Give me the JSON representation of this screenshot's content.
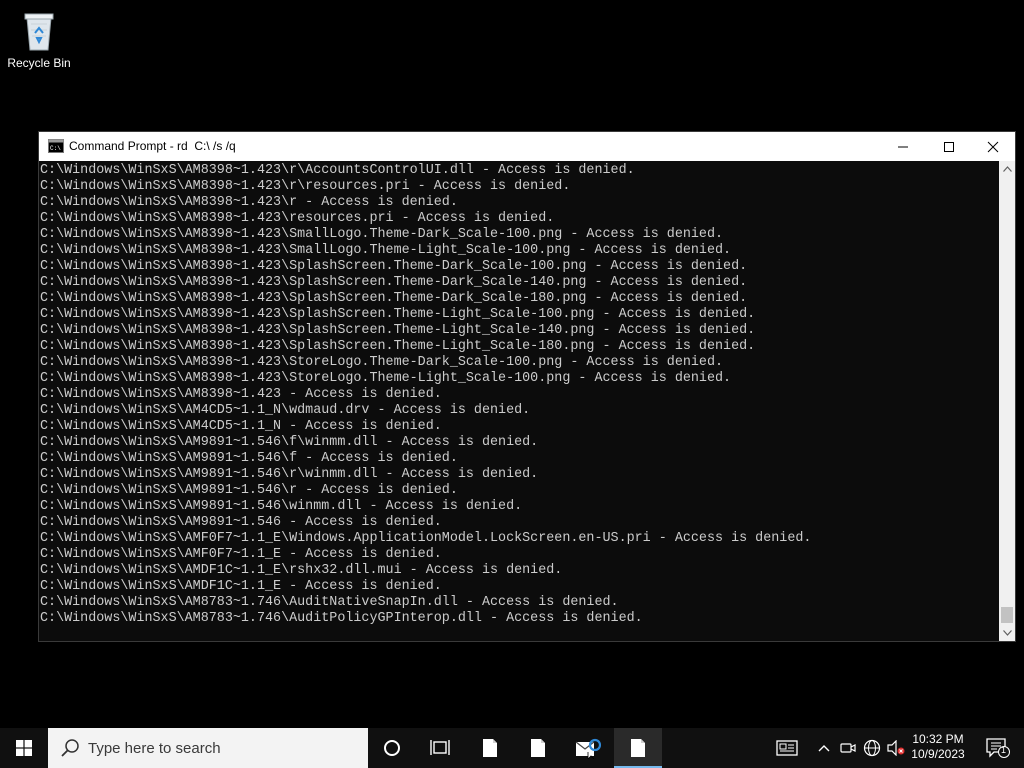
{
  "desktop": {
    "icons": [
      {
        "label": "Recycle Bin",
        "icon": "recycle-bin-icon"
      }
    ]
  },
  "window": {
    "title": "Command Prompt - rd  C:\\ /s /q",
    "icon": "cmd-icon",
    "controls": {
      "minimize": "minimize-icon",
      "maximize": "maximize-icon",
      "close": "close-icon"
    },
    "colors": {
      "console_bg": "#0c0c0c",
      "console_text": "#cccccc",
      "titlebar_bg": "#ffffff"
    },
    "console_lines": [
      "C:\\Windows\\WinSxS\\AM8398~1.423\\r\\AccountsControlUI.dll - Access is denied.",
      "C:\\Windows\\WinSxS\\AM8398~1.423\\r\\resources.pri - Access is denied.",
      "C:\\Windows\\WinSxS\\AM8398~1.423\\r - Access is denied.",
      "C:\\Windows\\WinSxS\\AM8398~1.423\\resources.pri - Access is denied.",
      "C:\\Windows\\WinSxS\\AM8398~1.423\\SmallLogo.Theme-Dark_Scale-100.png - Access is denied.",
      "C:\\Windows\\WinSxS\\AM8398~1.423\\SmallLogo.Theme-Light_Scale-100.png - Access is denied.",
      "C:\\Windows\\WinSxS\\AM8398~1.423\\SplashScreen.Theme-Dark_Scale-100.png - Access is denied.",
      "C:\\Windows\\WinSxS\\AM8398~1.423\\SplashScreen.Theme-Dark_Scale-140.png - Access is denied.",
      "C:\\Windows\\WinSxS\\AM8398~1.423\\SplashScreen.Theme-Dark_Scale-180.png - Access is denied.",
      "C:\\Windows\\WinSxS\\AM8398~1.423\\SplashScreen.Theme-Light_Scale-100.png - Access is denied.",
      "C:\\Windows\\WinSxS\\AM8398~1.423\\SplashScreen.Theme-Light_Scale-140.png - Access is denied.",
      "C:\\Windows\\WinSxS\\AM8398~1.423\\SplashScreen.Theme-Light_Scale-180.png - Access is denied.",
      "C:\\Windows\\WinSxS\\AM8398~1.423\\StoreLogo.Theme-Dark_Scale-100.png - Access is denied.",
      "C:\\Windows\\WinSxS\\AM8398~1.423\\StoreLogo.Theme-Light_Scale-100.png - Access is denied.",
      "C:\\Windows\\WinSxS\\AM8398~1.423 - Access is denied.",
      "C:\\Windows\\WinSxS\\AM4CD5~1.1_N\\wdmaud.drv - Access is denied.",
      "C:\\Windows\\WinSxS\\AM4CD5~1.1_N - Access is denied.",
      "C:\\Windows\\WinSxS\\AM9891~1.546\\f\\winmm.dll - Access is denied.",
      "C:\\Windows\\WinSxS\\AM9891~1.546\\f - Access is denied.",
      "C:\\Windows\\WinSxS\\AM9891~1.546\\r\\winmm.dll - Access is denied.",
      "C:\\Windows\\WinSxS\\AM9891~1.546\\r - Access is denied.",
      "C:\\Windows\\WinSxS\\AM9891~1.546\\winmm.dll - Access is denied.",
      "C:\\Windows\\WinSxS\\AM9891~1.546 - Access is denied.",
      "C:\\Windows\\WinSxS\\AMF0F7~1.1_E\\Windows.ApplicationModel.LockScreen.en-US.pri - Access is denied.",
      "C:\\Windows\\WinSxS\\AMF0F7~1.1_E - Access is denied.",
      "C:\\Windows\\WinSxS\\AMDF1C~1.1_E\\rshx32.dll.mui - Access is denied.",
      "C:\\Windows\\WinSxS\\AMDF1C~1.1_E - Access is denied.",
      "C:\\Windows\\WinSxS\\AM8783~1.746\\AuditNativeSnapIn.dll - Access is denied.",
      "C:\\Windows\\WinSxS\\AM8783~1.746\\AuditPolicyGPInterop.dll - Access is denied."
    ]
  },
  "taskbar": {
    "search_placeholder": "Type here to search",
    "pinned": [
      {
        "icon": "file-icon"
      },
      {
        "icon": "file-icon"
      },
      {
        "icon": "mail-icon"
      },
      {
        "icon": "file-icon",
        "active": true
      }
    ],
    "tray_icons": [
      "news-icon",
      "chevron-up-icon",
      "meet-now-icon",
      "network-icon",
      "volume-muted-icon"
    ],
    "time": "10:32 PM",
    "date": "10/9/2023",
    "notification_count": "1",
    "accent": "#76b9ed"
  }
}
